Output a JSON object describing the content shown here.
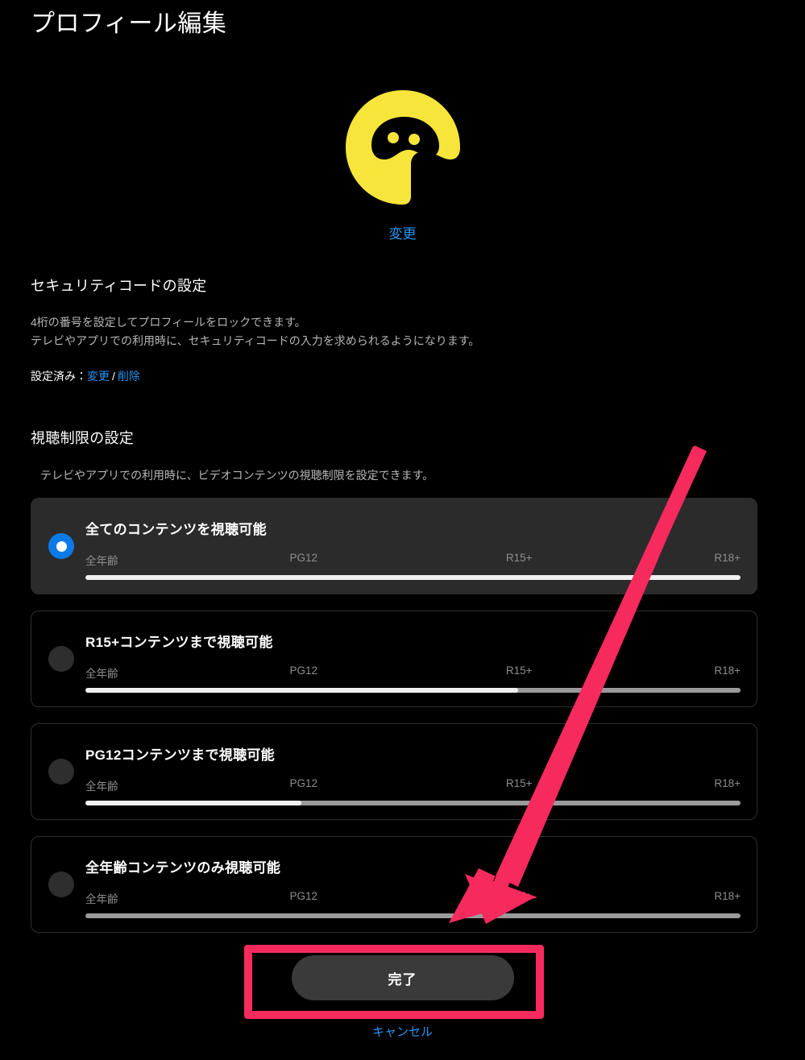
{
  "page": {
    "title": "プロフィール編集",
    "background_color": "#000000"
  },
  "avatar": {
    "icon": "profile-avatar-icon",
    "color": "#f7e53b",
    "change_label": "変更"
  },
  "security_section": {
    "heading": "セキュリティコードの設定",
    "desc_line1": "4桁の番号を設定してプロフィールをロックできます。",
    "desc_line2": "テレビやアプリでの利用時に、セキュリティコードの入力を求められるようになります。",
    "status_label": "設定済み：",
    "change_link": "変更",
    "separator": "/",
    "delete_link": "削除",
    "link_color": "#2196f3"
  },
  "restriction_section": {
    "heading": "視聴制限の設定",
    "description": "テレビやアプリでの利用時に、ビデオコンテンツの視聴制限を設定できます。",
    "scale_labels": [
      "全年齢",
      "PG12",
      "R15+",
      "R18+"
    ],
    "options": [
      {
        "label": "全てのコンテンツを視聴可能",
        "selected": true,
        "fill_percent": 100
      },
      {
        "label": "R15+コンテンツまで視聴可能",
        "selected": false,
        "fill_percent": 66
      },
      {
        "label": "PG12コンテンツまで視聴可能",
        "selected": false,
        "fill_percent": 33
      },
      {
        "label": "全年齢コンテンツのみ視聴可能",
        "selected": false,
        "fill_percent": 0
      }
    ],
    "selected_radio_color": "#0b7ae8",
    "bar_fill_color": "#efefef",
    "bar_track_color": "#9a9a9a"
  },
  "footer": {
    "done_label": "完了",
    "cancel_label": "キャンセル"
  },
  "annotation": {
    "color": "#f72a5e",
    "arrow": "pointer-arrow",
    "highlight": "done-button-highlight"
  }
}
